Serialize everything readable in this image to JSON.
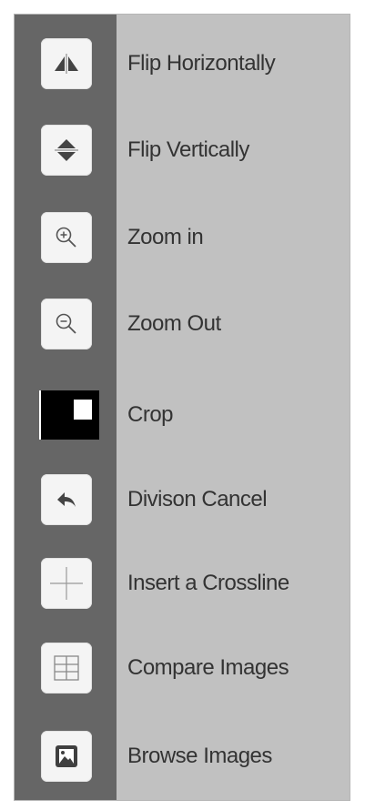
{
  "menu": {
    "items": [
      {
        "label": "Flip Horizontally",
        "icon": "flip-horizontal-icon"
      },
      {
        "label": "Flip Vertically",
        "icon": "flip-vertical-icon"
      },
      {
        "label": "Zoom in",
        "icon": "zoom-in-icon"
      },
      {
        "label": "Zoom Out",
        "icon": "zoom-out-icon"
      },
      {
        "label": "Crop",
        "icon": "crop-icon"
      },
      {
        "label": "Divison Cancel",
        "icon": "undo-arrow-icon"
      },
      {
        "label": "Insert a Crossline",
        "icon": "crossline-icon"
      },
      {
        "label": "Compare Images",
        "icon": "compare-grid-icon"
      },
      {
        "label": "Browse Images",
        "icon": "image-browse-icon"
      }
    ]
  },
  "colors": {
    "panel_background": "#c1c1c1",
    "icon_rail": "#666666",
    "icon_tile": "#f4f4f4",
    "label_text": "#333333"
  }
}
